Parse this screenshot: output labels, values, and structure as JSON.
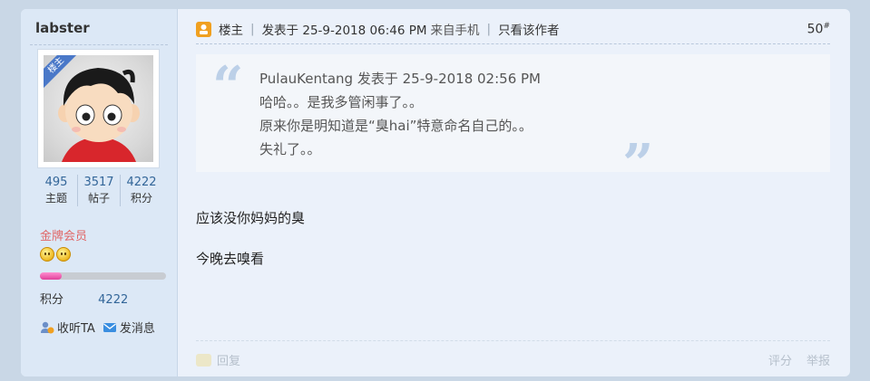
{
  "user": {
    "name": "labster",
    "badge": "楼主",
    "stats": [
      {
        "value": "495",
        "label": "主题"
      },
      {
        "value": "3517",
        "label": "帖子"
      },
      {
        "value": "4222",
        "label": "积分"
      }
    ],
    "rank": "金牌会员",
    "progress_fraction": 0.17,
    "credit_label": "积分",
    "credit_value": "4222",
    "follow_label": "收听TA",
    "message_label": "发消息"
  },
  "post": {
    "author_tag": "楼主",
    "posted_at": "发表于 25-9-2018 06:46 PM",
    "source": "来自手机",
    "only_author": "只看该作者",
    "floor_number": "50",
    "floor_symbol": "#",
    "quote": {
      "header": "PulauKentang 发表于 25-9-2018 02:56 PM",
      "lines": [
        "哈哈。。是我多管闲事了。。",
        "原来你是明知道是“臭hai”特意命名自己的。。",
        "失礼了。。"
      ]
    },
    "body": [
      "应该没你妈妈的臭",
      "今晚去嗅看"
    ],
    "reply_label": "回复",
    "rate_label": "评分",
    "report_label": "举报"
  },
  "colors": {
    "page_bg": "#c9d7e6",
    "side_bg": "#dce8f6",
    "accent_link": "#336699",
    "rank_color": "#e06666"
  }
}
